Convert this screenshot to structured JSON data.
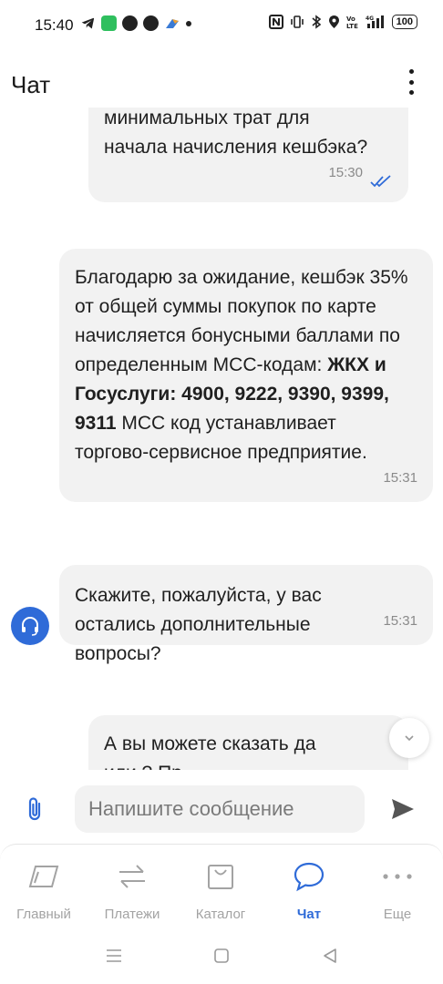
{
  "status_bar": {
    "time": "15:40",
    "battery": "100"
  },
  "header": {
    "title": "Чат"
  },
  "chat": {
    "messages": [
      {
        "line1": "минимальных трат для",
        "line2": "начала начисления кешбэка?",
        "time": "15:30"
      },
      {
        "part1": "Благодарю за ожидание, кешбэк 35% от общей суммы покупок по карте начисляется бонусными баллами по определенным MCC-кодам: ",
        "bold": "ЖКХ и Госуслуги: 4900, 9222, 9390, 9399, 9311",
        "part2": " MCC код устанавливает торгово-сервисное предприятие.",
        "time": "15:31"
      },
      {
        "text": "Скажите, пожалуйста, у вас остались дополнительные вопросы?",
        "time": "15:31"
      },
      {
        "line1": "А вы можете сказать да",
        "line2": "или ? Пр"
      }
    ]
  },
  "input": {
    "placeholder": "Напишите сообщение"
  },
  "nav": {
    "items": [
      {
        "label": "Главный"
      },
      {
        "label": "Платежи"
      },
      {
        "label": "Каталог"
      },
      {
        "label": "Чат"
      },
      {
        "label": "Еще"
      }
    ]
  },
  "colors": {
    "accent": "#2f6bd8",
    "bubble": "#f2f2f2",
    "inactive": "#a3a3a3"
  }
}
